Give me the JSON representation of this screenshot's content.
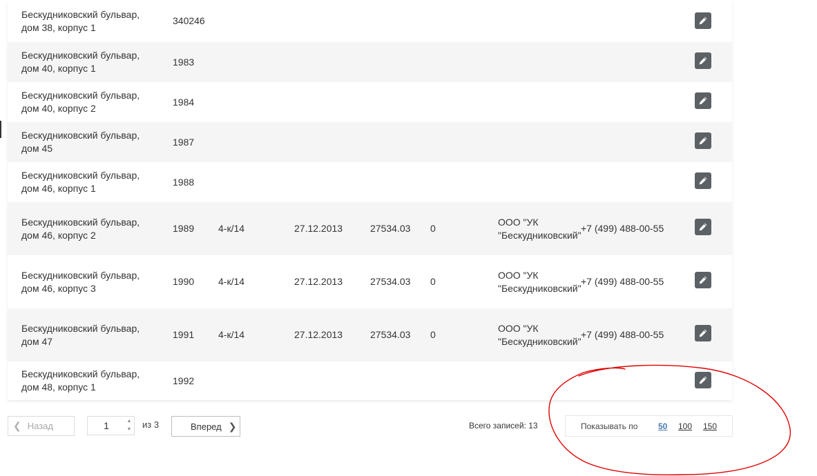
{
  "table": {
    "rows": [
      {
        "address": "Бескудниковский бульвар, дом 38, корпус 1",
        "num": "340246",
        "type": "",
        "date": "",
        "amount": "",
        "zero": "",
        "company": "",
        "phone": ""
      },
      {
        "address": "Бескудниковский бульвар, дом 40, корпус 1",
        "num": "1983",
        "type": "",
        "date": "",
        "amount": "",
        "zero": "",
        "company": "",
        "phone": ""
      },
      {
        "address": "Бескудниковский бульвар, дом 40, корпус 2",
        "num": "1984",
        "type": "",
        "date": "",
        "amount": "",
        "zero": "",
        "company": "",
        "phone": ""
      },
      {
        "address": "Бескудниковский бульвар, дом 45",
        "num": "1987",
        "type": "",
        "date": "",
        "amount": "",
        "zero": "",
        "company": "",
        "phone": ""
      },
      {
        "address": "Бескудниковский бульвар, дом 46, корпус 1",
        "num": "1988",
        "type": "",
        "date": "",
        "amount": "",
        "zero": "",
        "company": "",
        "phone": ""
      },
      {
        "address": "Бескудниковский бульвар, дом 46, корпус 2",
        "num": "1989",
        "type": "4-к/14",
        "date": "27.12.2013",
        "amount": "27534.03",
        "zero": "0",
        "company": "ООО \"УК \"Бескудниковский\"",
        "phone": "+7 (499) 488-00-55"
      },
      {
        "address": "Бескудниковский бульвар, дом 46, корпус 3",
        "num": "1990",
        "type": "4-к/14",
        "date": "27.12.2013",
        "amount": "27534.03",
        "zero": "0",
        "company": "ООО \"УК \"Бескудниковский\"",
        "phone": "+7 (499) 488-00-55"
      },
      {
        "address": "Бескудниковский бульвар, дом 47",
        "num": "1991",
        "type": "4-к/14",
        "date": "27.12.2013",
        "amount": "27534.03",
        "zero": "0",
        "company": "ООО \"УК \"Бескудниковский\"",
        "phone": "+7 (499) 488-00-55"
      },
      {
        "address": "Бескудниковский бульвар, дом 48, корпус 1",
        "num": "1992",
        "type": "",
        "date": "",
        "amount": "",
        "zero": "",
        "company": "",
        "phone": ""
      }
    ],
    "edit_icon": "pencil-icon"
  },
  "pagination": {
    "prev_label": "Назад",
    "page_value": "1",
    "of_label": "из 3",
    "next_label": "Вперед",
    "prev_icon": "chevron-left-icon",
    "next_icon": "chevron-right-icon"
  },
  "total": {
    "label": "Всего записей: 13"
  },
  "per_page": {
    "label": "Показывать по",
    "options": [
      "50",
      "100",
      "150"
    ],
    "selected": "50"
  },
  "colors": {
    "alt_row": "#f5f5f5",
    "edit_button": "#5c6166",
    "active_link": "#4a7ab0",
    "annotation": "#e00000"
  }
}
